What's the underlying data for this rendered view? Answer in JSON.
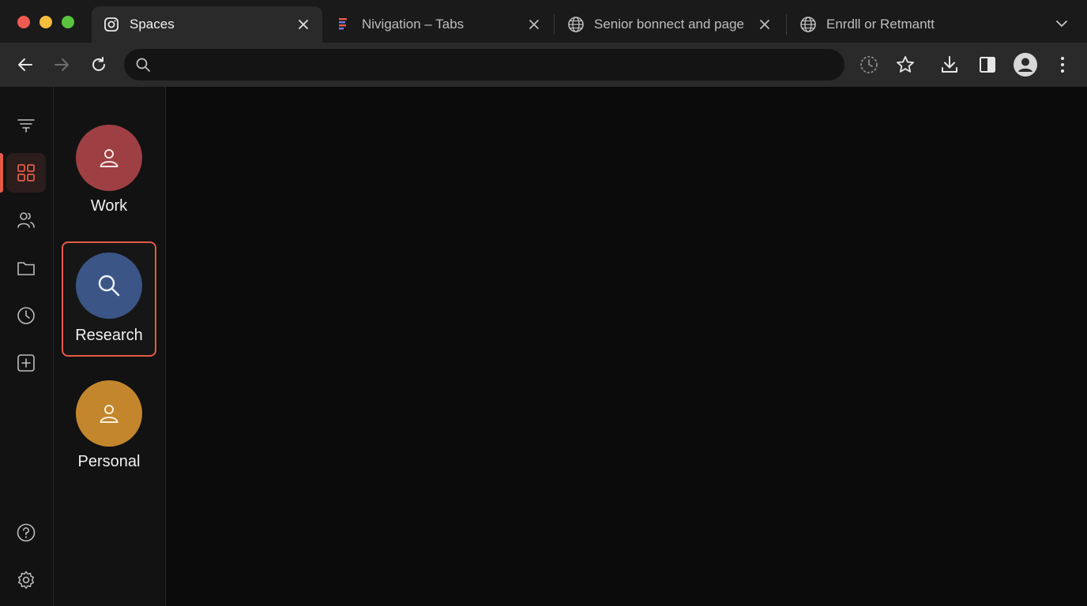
{
  "tabs": [
    {
      "title": "Spaces",
      "icon": "instagram-icon",
      "active": true
    },
    {
      "title": "Nivigation – Tabs",
      "icon": "figma-icon",
      "active": false
    },
    {
      "title": "Senior bonnect and page",
      "icon": "globe-icon",
      "active": false
    },
    {
      "title": "Enrdll or Retmantt",
      "icon": "globe-icon",
      "active": false
    }
  ],
  "omnibox": {
    "value": "",
    "placeholder": ""
  },
  "rail": {
    "items": [
      "menu-icon",
      "grid-icon",
      "people-icon",
      "folder-icon",
      "clock-icon",
      "add-square-icon",
      "help-icon",
      "settings-icon"
    ],
    "active": "grid-icon"
  },
  "spaces": [
    {
      "label": "Work",
      "color": "#9e3f44",
      "icon": "person-icon",
      "selected": false
    },
    {
      "label": "Research",
      "color": "#3a5586",
      "icon": "search-icon",
      "selected": true
    },
    {
      "label": "Personal",
      "color": "#c3862c",
      "icon": "person-icon",
      "selected": false
    }
  ],
  "colors": {
    "accent": "#e35b47",
    "background": "#0b0b0b",
    "toolbar": "#2a2a2a"
  }
}
